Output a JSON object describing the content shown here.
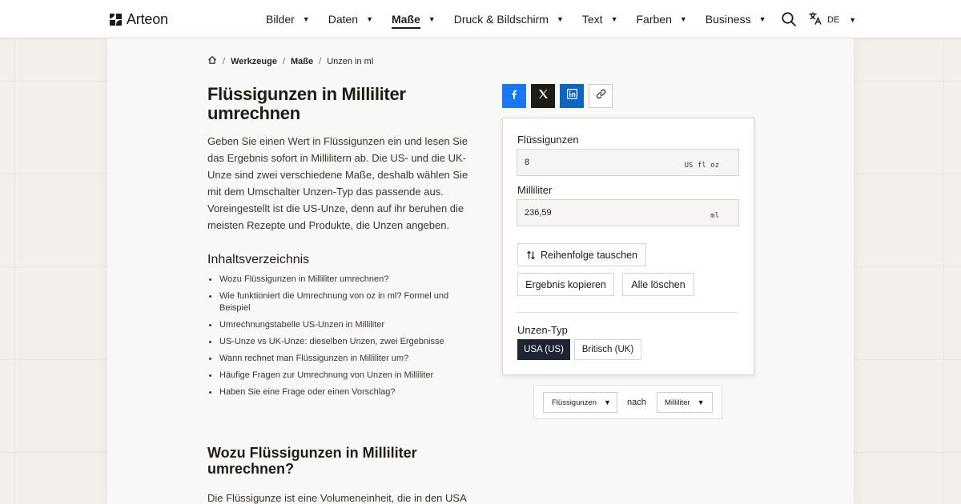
{
  "header": {
    "brand": "Arteon",
    "nav": [
      {
        "label": "Bilder",
        "active": false
      },
      {
        "label": "Daten",
        "active": false
      },
      {
        "label": "Maße",
        "active": true
      },
      {
        "label": "Druck & Bildschirm",
        "active": false
      },
      {
        "label": "Text",
        "active": false
      },
      {
        "label": "Farben",
        "active": false
      },
      {
        "label": "Business",
        "active": false
      }
    ],
    "language": "DE",
    "icons": {
      "search": "search-icon",
      "translate": "translate-icon",
      "home": "home-icon"
    }
  },
  "breadcrumb": [
    "Werkzeuge",
    "Maße",
    "Unzen in ml"
  ],
  "article": {
    "title": "Flüssigunzen in Milliliter umrechnen",
    "intro": "Geben Sie einen Wert in Flüssigunzen ein und lesen Sie das Ergebnis sofort in Millilitern ab. Die US- und die UK-Unze sind zwei verschiedene Maße, deshalb wählen Sie mit dem Umschalter Unzen-Typ das passende aus. Voreingestellt ist die US-Unze, denn auf ihr beruhen die meisten Rezepte und Produkte, die Unzen angeben.",
    "toc_title": "Inhaltsverzeichnis",
    "toc": [
      "Wozu Flüssigunzen in Milliliter umrechnen?",
      "Wie funktioniert die Umrechnung von oz in ml? Formel und Beispiel",
      "Umrechnungstabelle US-Unzen in Milliliter",
      "US-Unze vs UK-Unze: dieselben Unzen, zwei Ergebnisse",
      "Wann rechnet man Flüssigunzen in Milliliter um?",
      "Häufige Fragen zur Umrechnung von Unzen in Milliliter",
      "Haben Sie eine Frage oder einen Vorschlag?"
    ],
    "section_title": "Wozu Flüssigunzen in Milliliter umrechnen?",
    "section_text": "Die Flüssigunze ist eine Volumeneinheit, die in den USA"
  },
  "share": {
    "icons": [
      "facebook-icon",
      "x-icon",
      "linkedin-icon",
      "link-icon"
    ],
    "colors": {
      "facebook": "#1877f2",
      "x": "#1f1b16",
      "linkedin": "#0a66c2"
    }
  },
  "converter": {
    "input_label": "Flüssigunzen",
    "input_value": "8",
    "input_unit": "US fl oz",
    "output_label": "Milliliter",
    "output_value": "236,59",
    "output_unit": "ml",
    "swap_label": "Reihenfolge tauschen",
    "copy_label": "Ergebnis kopieren",
    "clear_label": "Alle löschen",
    "type_label": "Unzen-Typ",
    "types": [
      {
        "label": "USA (US)",
        "selected": true
      },
      {
        "label": "Britisch (UK)",
        "selected": false
      }
    ]
  },
  "pair": {
    "from": "Flüssigunzen",
    "connector": "nach",
    "to": "Milliliter"
  },
  "colors": {
    "accent_dark": "#1f2433",
    "text": "#1f1b16"
  }
}
